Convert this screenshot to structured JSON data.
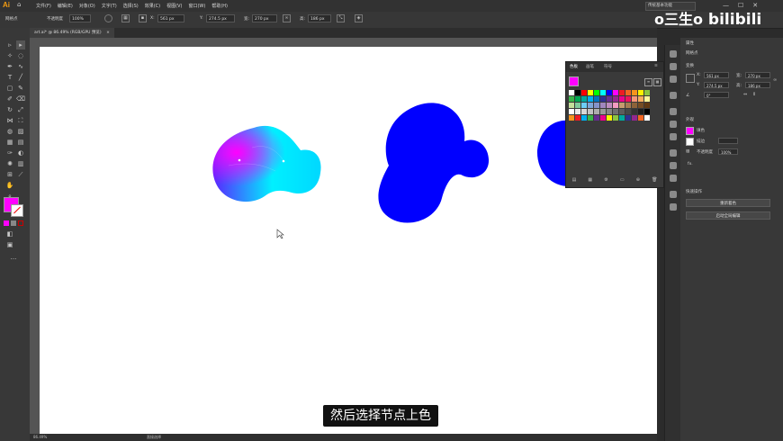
{
  "menubar": {
    "logo": "Ai",
    "items": [
      "文件(F)",
      "编辑(E)",
      "对象(O)",
      "文字(T)",
      "选择(S)",
      "效果(C)",
      "视图(V)",
      "窗口(W)",
      "帮助(H)"
    ],
    "workspace": "传统基本功能",
    "watermark_text": "o三生o",
    "watermark_logo": "bilibili"
  },
  "control_bar": {
    "selection_label": "网格点",
    "opacity_label": "不透明度",
    "opacity_value": "100%",
    "x_value": "561 px",
    "y_value": "274.5 px",
    "w_value": "270 px",
    "h_value": "186 px"
  },
  "document_tab": {
    "title": "art.ai* @ 86.49% (RGB/GPU 预览)",
    "close": "×"
  },
  "swatches_panel": {
    "tabs": [
      "色板",
      "画笔",
      "符号"
    ],
    "swatch_colors": [
      [
        "#ffffff",
        "#000000",
        "#ff0000",
        "#ffff00",
        "#00ff00",
        "#00ffff",
        "#0000ff",
        "#ff00ff",
        "#ed1c24",
        "#f26522",
        "#f7941d",
        "#fff200",
        "#8dc63f"
      ],
      [
        "#39b54a",
        "#00a651",
        "#00a99d",
        "#00aeef",
        "#0072bc",
        "#2e3192",
        "#662d91",
        "#92278f",
        "#ec008c",
        "#ed145b",
        "#f69679",
        "#fbaf5d",
        "#fff799"
      ],
      [
        "#c4df9b",
        "#82ca9c",
        "#6dcff6",
        "#7da7d9",
        "#8493ca",
        "#a186be",
        "#bd8cbf",
        "#f49ac1",
        "#c69c6d",
        "#a67c52",
        "#8c6239",
        "#754c24",
        "#603913"
      ],
      [
        "#ffffff",
        "#ebebeb",
        "#d7d7d7",
        "#c2c2c2",
        "#adadad",
        "#999999",
        "#858585",
        "#707070",
        "#5c5c5c",
        "#474747",
        "#333333",
        "#1f1f1f",
        "#000000"
      ],
      [
        "#f7941d",
        "#ed1c24",
        "#00aeef",
        "#39b54a",
        "#662d91",
        "#ec008c",
        "#fff200",
        "#8dc63f",
        "#00a99d",
        "#2e3192",
        "#92278f",
        "#f26522",
        "#ffffff"
      ]
    ]
  },
  "properties_panel": {
    "title": "属性",
    "selection_type": "网格点",
    "transform_label": "变换",
    "x_label": "X:",
    "x_value": "561 px",
    "y_label": "Y:",
    "y_value": "274.5 px",
    "w_label": "宽:",
    "w_value": "270 px",
    "h_label": "高:",
    "h_value": "186 px",
    "angle_value": "0°",
    "appearance_label": "外观",
    "fill_label": "填色",
    "stroke_label": "描边",
    "opacity_label": "不透明度",
    "opacity_value": "100%",
    "fx_label": "fx.",
    "quick_actions_label": "快速操作",
    "btn_reset_envelope": "重新着色",
    "btn_global_edit": "启动全局编辑"
  },
  "colors": {
    "fill_swatch": "#ff00ff",
    "blob_blue": "#0000ff",
    "gradient_magenta": "#ff00ff",
    "gradient_cyan": "#00f0ff",
    "gradient_blue": "#1a20ff"
  },
  "status_bar": {
    "zoom": "86.49%",
    "mode": "直接选择"
  },
  "subtitle": "然后选择节点上色"
}
